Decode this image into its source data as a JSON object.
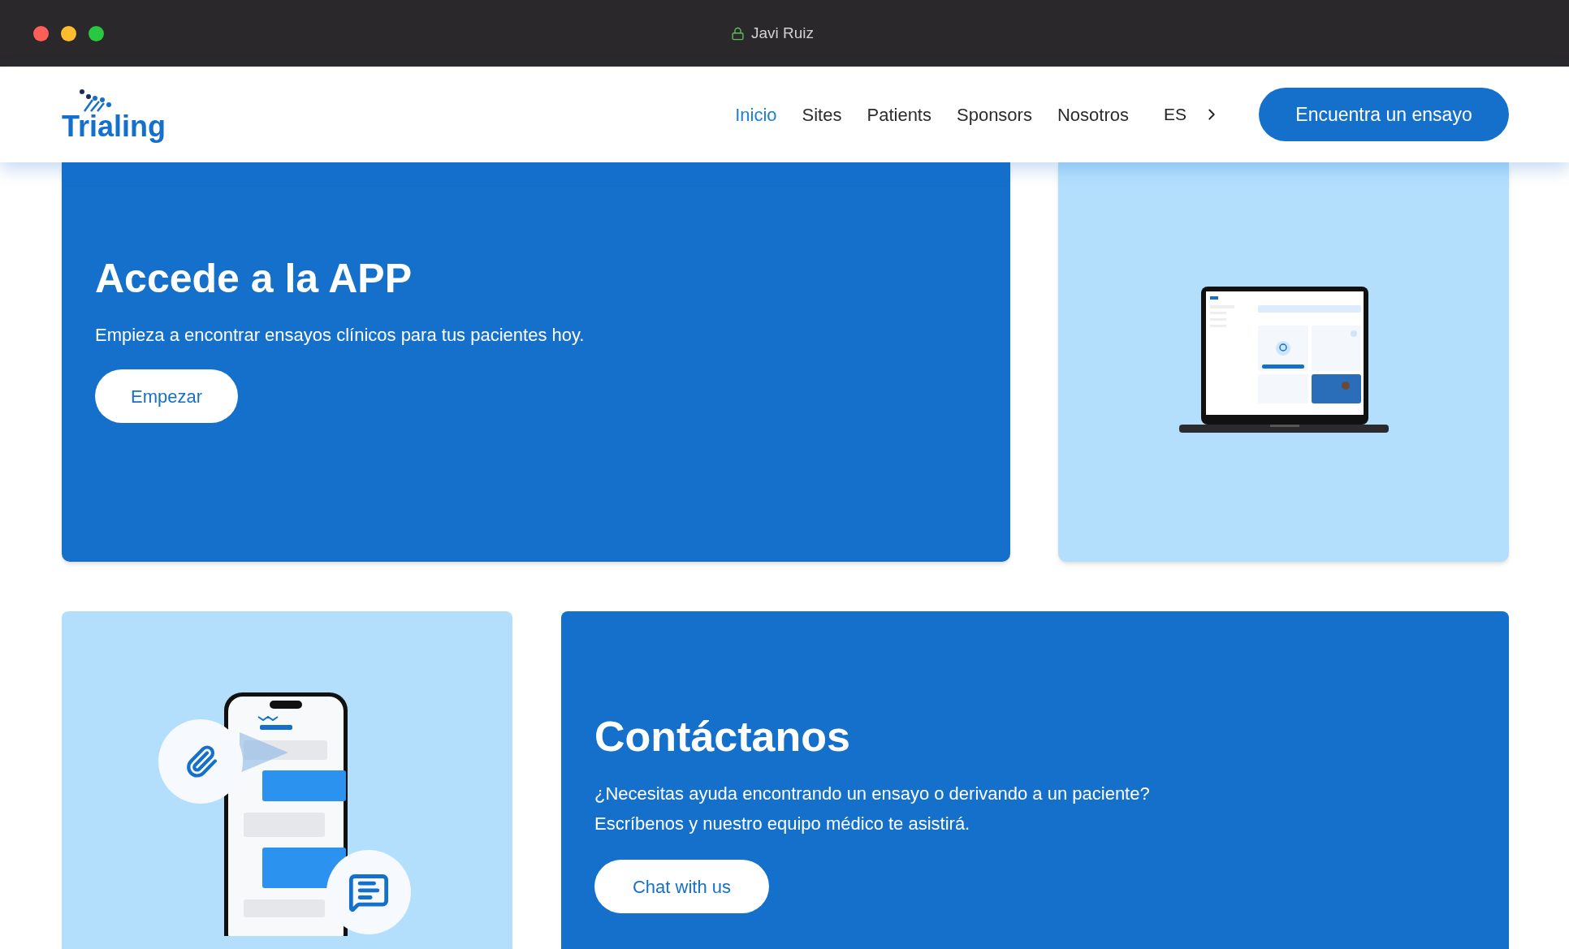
{
  "window": {
    "title": "Javi Ruiz"
  },
  "header": {
    "logo": "Trialing",
    "nav": [
      {
        "label": "Inicio",
        "selected": true
      },
      {
        "label": "Sites",
        "selected": false
      },
      {
        "label": "Patients",
        "selected": false
      },
      {
        "label": "Sponsors",
        "selected": false
      },
      {
        "label": "Nosotros",
        "selected": false
      }
    ],
    "language": "ES",
    "cta": "Encuentra un ensayo"
  },
  "app_card": {
    "title": "Accede a la APP",
    "text": "Empieza a encontrar ensayos clínicos para tus pacientes hoy.",
    "button": "Empezar"
  },
  "contact_card": {
    "title": "Contáctanos",
    "text": "¿Necesitas ayuda encontrando un ensayo o derivando a un paciente? Escríbenos y nuestro equipo médico te asistirá.",
    "button": "Chat with us"
  }
}
